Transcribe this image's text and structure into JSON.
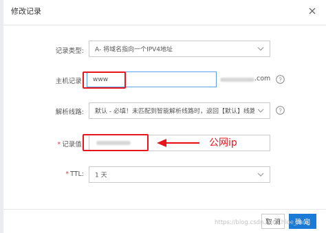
{
  "dialog": {
    "title": "修改记录"
  },
  "form": {
    "record_type": {
      "label": "记录类型:",
      "value": "A- 将域名指向一个IPV4地址"
    },
    "host": {
      "label": "主机记录:",
      "value": "www",
      "domain_suffix": ".com"
    },
    "line": {
      "label": "解析线路:",
      "value": "默认 - 必填！未匹配到智能解析线路时，返回【默认】线路设..."
    },
    "record_value": {
      "required_mark": "*",
      "label": "记录值:",
      "value": ""
    },
    "ttl": {
      "required_mark": "*",
      "label": "TTL:",
      "value": "1 天"
    }
  },
  "annotation": {
    "text": "公网ip",
    "color": "#e8141b"
  },
  "footer": {
    "cancel_label": "取 消",
    "confirm_label": "确 定"
  },
  "watermark": "https://blog.csdn.net/Chloe_Yang",
  "icons": [
    "close-icon",
    "chevron-down-icon",
    "help-icon",
    "arrow-left-icon"
  ],
  "colors": {
    "primary": "#1a7ad6",
    "annotation_red": "#e8141b",
    "border": "#c9c9c9"
  }
}
